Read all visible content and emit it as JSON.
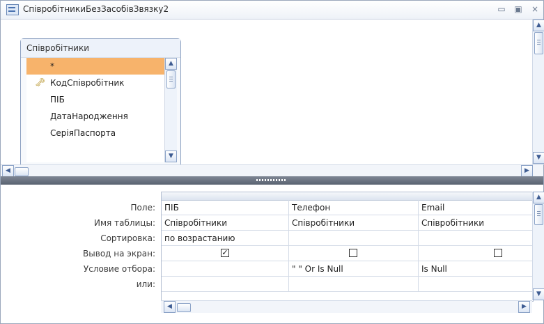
{
  "window": {
    "title": "СпівробітникиБезЗасобівЗвязку2",
    "controls": [
      "▭",
      "▣",
      "×"
    ]
  },
  "table_list": {
    "name": "Співробітники",
    "fields": [
      {
        "label": "*",
        "key": false,
        "selected": true
      },
      {
        "label": "КодСпівробітник",
        "key": true,
        "selected": false
      },
      {
        "label": "ПІБ",
        "key": false,
        "selected": false
      },
      {
        "label": "ДатаНародження",
        "key": false,
        "selected": false
      },
      {
        "label": "СеріяПаспорта",
        "key": false,
        "selected": false
      }
    ]
  },
  "query_grid": {
    "row_labels": [
      "Поле:",
      "Имя таблицы:",
      "Сортировка:",
      "Вывод на экран:",
      "Условие отбора:",
      "или:"
    ],
    "columns": [
      {
        "field": "ПІБ",
        "table": "Співробітники",
        "sort": "по возрастанию",
        "show": true,
        "criteria": "",
        "or": ""
      },
      {
        "field": "Телефон",
        "table": "Співробітники",
        "sort": "",
        "show": false,
        "criteria": "\" \" Or Is Null",
        "or": ""
      },
      {
        "field": "Email",
        "table": "Співробітники",
        "sort": "",
        "show": false,
        "criteria": "Is Null",
        "or": ""
      }
    ]
  },
  "icons": {
    "key": "key-icon",
    "check": "✓",
    "up": "▲",
    "down": "▼",
    "left": "◀",
    "right": "▶"
  },
  "colors": {
    "selected_field": "#f7b36b",
    "splitter": "#6b7381",
    "accent_blue": "#8da4c8"
  }
}
